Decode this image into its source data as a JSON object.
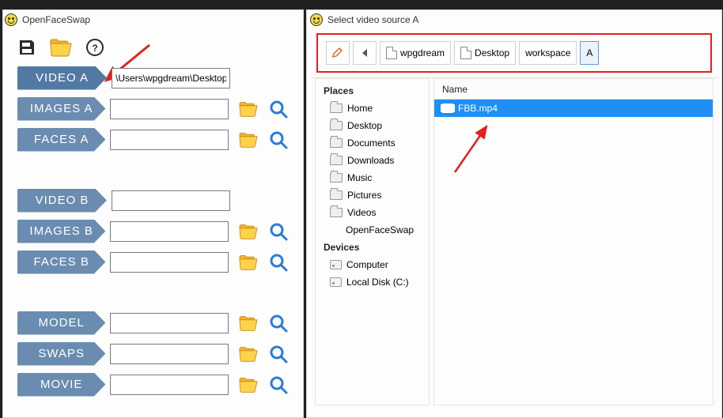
{
  "main_window": {
    "title": "OpenFaceSwap",
    "rows": {
      "video_a": {
        "label": "VIDEO A",
        "value": "\\Users\\wpgdream\\Desktop\\"
      },
      "images_a": {
        "label": "IMAGES A",
        "value": ""
      },
      "faces_a": {
        "label": "FACES A",
        "value": ""
      },
      "video_b": {
        "label": "VIDEO B",
        "value": ""
      },
      "images_b": {
        "label": "IMAGES B",
        "value": ""
      },
      "faces_b": {
        "label": "FACES B",
        "value": ""
      },
      "model": {
        "label": "MODEL",
        "value": ""
      },
      "swaps": {
        "label": "SWAPS",
        "value": ""
      },
      "movie": {
        "label": "MOVIE",
        "value": ""
      }
    }
  },
  "dialog": {
    "title": "Select video source A",
    "breadcrumbs": {
      "wpgdream": "wpgdream",
      "desktop": "Desktop",
      "workspace": "workspace",
      "a": "A"
    },
    "places_header": "Places",
    "devices_header": "Devices",
    "places": {
      "home": "Home",
      "desktop": "Desktop",
      "documents": "Documents",
      "downloads": "Downloads",
      "music": "Music",
      "pictures": "Pictures",
      "videos": "Videos",
      "ofs": "OpenFaceSwap"
    },
    "devices": {
      "computer": "Computer",
      "disk_c": "Local Disk (C:)"
    },
    "file_list_header": "Name",
    "files": {
      "fbb": "FBB.mp4"
    }
  }
}
